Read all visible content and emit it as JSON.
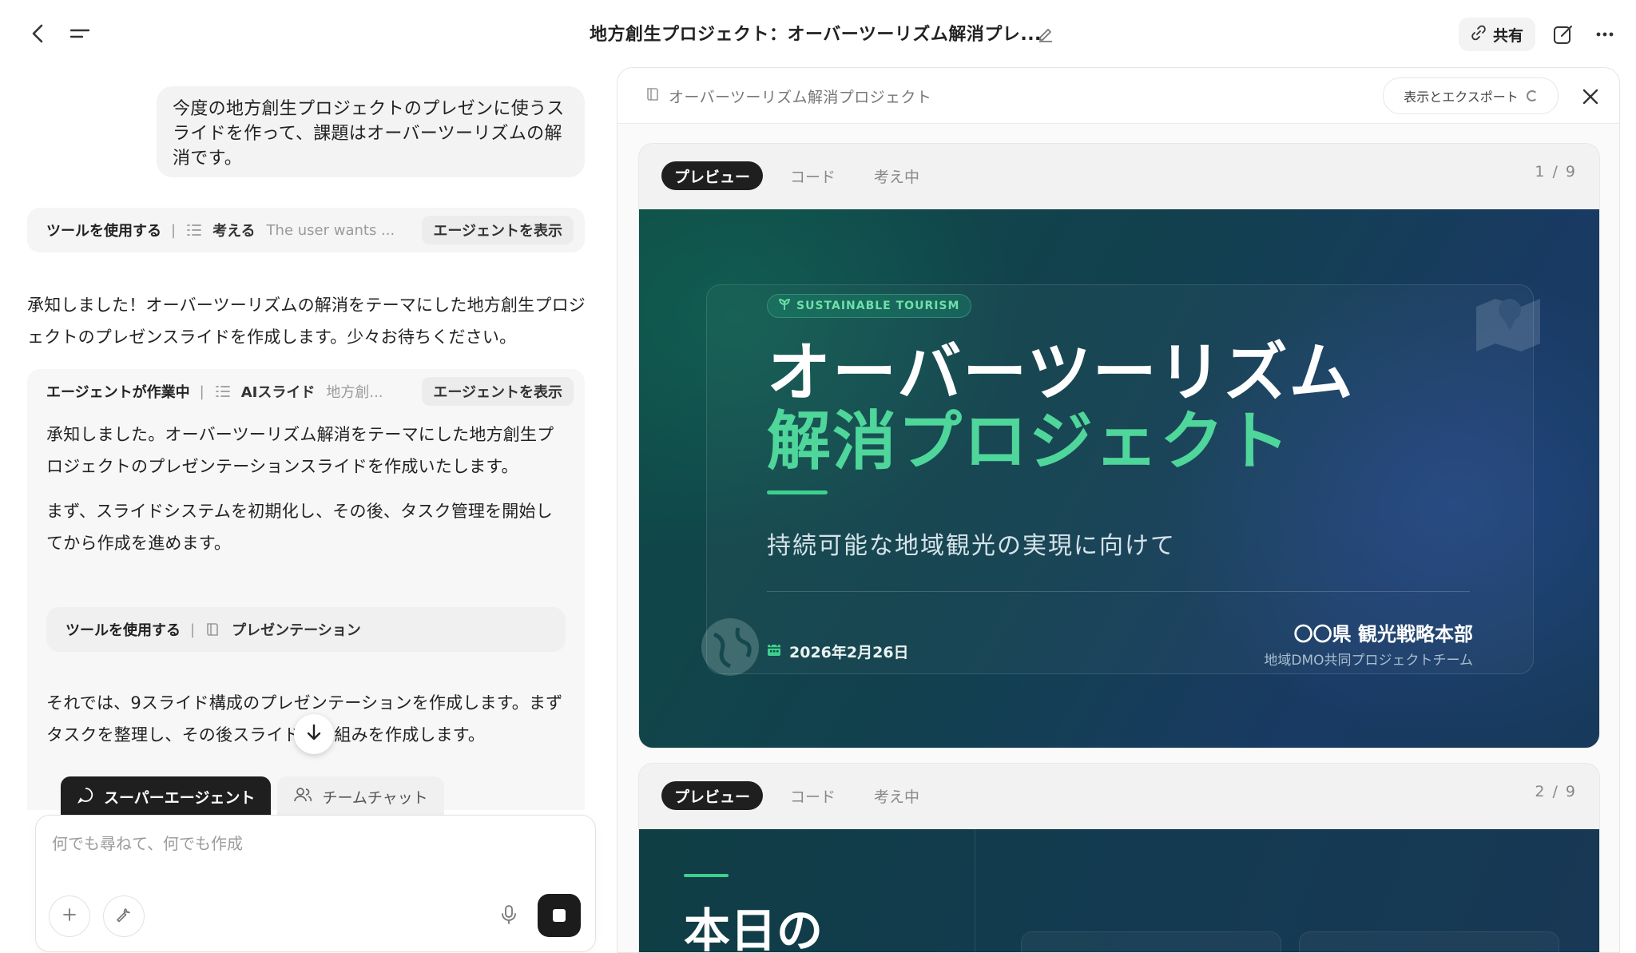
{
  "topbar": {
    "title": "地方創生プロジェクト：オーバーツーリズム解消プレ...",
    "share_label": "共有"
  },
  "chat": {
    "user_message": "今度の地方創生プロジェクトのプレゼンに使うスライドを作って、課題はオーバーツーリズムの解消です。",
    "tool_pill": {
      "strong": "ツールを使用する",
      "sep": "|",
      "think": "考える",
      "muted": "The user wants ...",
      "button": "エージェントを表示"
    },
    "assistant_message": "承知しました！オーバーツーリズムの解消をテーマにした地方創生プロジェクトのプレゼンスライドを作成します。少々お待ちください。",
    "agent_card": {
      "status": "エージェントが作業中",
      "sep": "|",
      "tool": "AIスライド",
      "muted": "地方創...",
      "button": "エージェントを表示",
      "paragraph1": "承知しました。オーバーツーリズム解消をテーマにした地方創生プロジェクトのプレゼンテーションスライドを作成いたします。",
      "paragraph2": "まず、スライドシステムを初期化し、その後、タスク管理を開始してから作成を進めます。",
      "inner_tool_strong": "ツールを使用する",
      "inner_tool_sep": "|",
      "inner_tool_label": "プレゼンテーション",
      "paragraph3": "それでは、9スライド構成のプレゼンテーションを作成します。まずタスクを整理し、その後スライドの骨組みを作成します。"
    },
    "mode_tabs": [
      {
        "label": "スーパーエージェント",
        "icon": "chat-bubble-icon"
      },
      {
        "label": "チームチャット",
        "icon": "people-icon"
      }
    ],
    "composer": {
      "placeholder": "何でも尋ねて、何でも作成",
      "value": ""
    }
  },
  "preview": {
    "title": "オーバーツーリズム解消プロジェクト",
    "export_label": "表示とエクスポート",
    "slides": [
      {
        "tabs": [
          "プレビュー",
          "コード",
          "考え中"
        ],
        "count": "1 / 9",
        "badge": "SUSTAINABLE TOURISM",
        "title_line1": "オーバーツーリズム",
        "title_line2": "解消プロジェクト",
        "subtitle": "持続可能な地域観光の実現に向けて",
        "date": "2026年2月26日",
        "org": "〇〇県 観光戦略本部",
        "team": "地域DMO共同プロジェクトチーム"
      },
      {
        "tabs": [
          "プレビュー",
          "コード",
          "考え中"
        ],
        "count": "2 / 9",
        "title": "本日の"
      }
    ]
  },
  "colors": {
    "accent_green": "#4fd69a",
    "slide_bg_teal": "#0f4a45",
    "slide_bg_navy": "#193a63",
    "dark_button": "#1c1c1c"
  }
}
